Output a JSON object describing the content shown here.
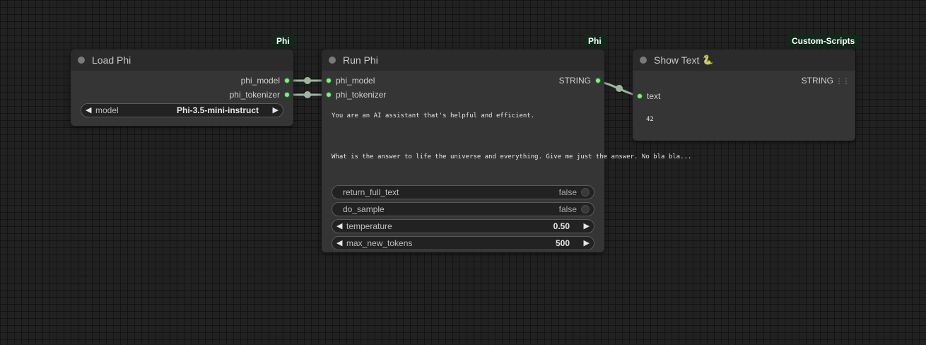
{
  "nodes": {
    "load_phi": {
      "badge": "Phi",
      "title": "Load Phi",
      "outputs": [
        "phi_model",
        "phi_tokenizer"
      ],
      "widget_model": {
        "label": "model",
        "value": "Phi-3.5-mini-instruct"
      }
    },
    "run_phi": {
      "badge": "Phi",
      "title": "Run Phi",
      "inputs": [
        "phi_model",
        "phi_tokenizer"
      ],
      "output": "STRING",
      "system_prompt": "You are an AI assistant that's helpful and efficient.",
      "user_prompt": "What is the answer to life the universe and everything. Give me just the answer. No bla bla...",
      "widgets": {
        "return_full_text": {
          "label": "return_full_text",
          "value": "false"
        },
        "do_sample": {
          "label": "do_sample",
          "value": "false"
        },
        "temperature": {
          "label": "temperature",
          "value": "0.50"
        },
        "max_new_tokens": {
          "label": "max_new_tokens",
          "value": "500"
        }
      }
    },
    "show_text": {
      "badge": "Custom-Scripts",
      "title": "Show Text",
      "title_icon": "snake-emoji-icon",
      "output": "STRING",
      "input": "text",
      "value": "42"
    }
  },
  "colors": {
    "canvas": "#212121",
    "node_body": "#353535",
    "node_header": "#2b2b2b",
    "badge_bg": "#0f2a18",
    "slot_dot": "#7ef27e",
    "link": "#9fb59f"
  },
  "icons": {
    "node_status": "status-dot-icon",
    "arrow_left": "triangle-left-icon",
    "arrow_right": "triangle-right-icon",
    "grid": "grid-icon"
  }
}
